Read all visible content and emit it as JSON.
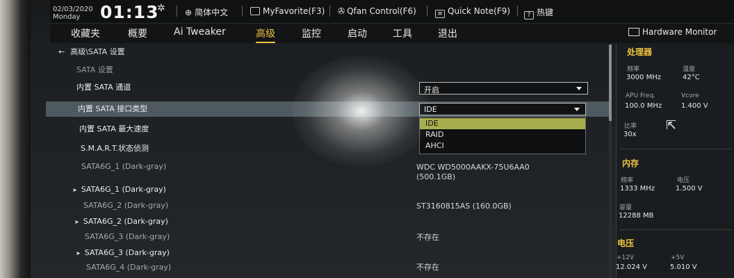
{
  "topbar": {
    "date": "02/03/2020",
    "day": "Monday",
    "time": "01:13",
    "language": "简体中文",
    "myfavorite": "MyFavorite(F3)",
    "qfan": "Qfan Control(F6)",
    "quicknote": "Quick Note(F9)",
    "hotkeys": "热键"
  },
  "menu": {
    "items": [
      "收藏夹",
      "概要",
      "Ai Tweaker",
      "高级",
      "监控",
      "启动",
      "工具",
      "退出"
    ],
    "active": "高级"
  },
  "main": {
    "breadcrumb": "高级\\SATA 设置",
    "subtitle": "SATA 设置",
    "rows": {
      "sata_channel": {
        "label": "内置 SATA 通道",
        "value": "开启"
      },
      "sata_mode": {
        "label": "内置 SATA 接口类型",
        "value": "IDE"
      },
      "sata_speed": {
        "label": "内置 SATA 最大速度"
      },
      "smart": {
        "label": "S.M.A.R.T.状态侦测"
      },
      "port1_info": {
        "label": "SATA6G_1 (Dark-gray)",
        "value_line1": "WDC WD5000AAKX-75U6AA0",
        "value_line2": "(500.1GB)"
      },
      "port1": {
        "label": "SATA6G_1 (Dark-gray)"
      },
      "port2_info": {
        "label": "SATA6G_2 (Dark-gray)",
        "value": "ST3160815AS (160.0GB)"
      },
      "port2": {
        "label": "SATA6G_2 (Dark-gray)"
      },
      "port3_info": {
        "label": "SATA6G_3 (Dark-gray)",
        "value": "不存在"
      },
      "port3": {
        "label": "SATA6G_3 (Dark-gray)"
      },
      "port4_info": {
        "label": "SATA6G_4 (Dark-gray)",
        "value": "不存在"
      }
    },
    "dropdown_options": [
      "IDE",
      "RAID",
      "AHCI"
    ],
    "dropdown_selected": "IDE"
  },
  "hardware_monitor": {
    "title": "Hardware Monitor",
    "cpu": {
      "section": "处理器",
      "freq_label": "频率",
      "freq_value": "3000 MHz",
      "temp_label": "温度",
      "temp_value": "42°C",
      "apu_label": "APU Freq.",
      "apu_value": "100.0 MHz",
      "vcore_label": "Vcore",
      "vcore_value": "1.400 V",
      "ratio_label": "比率",
      "ratio_value": "30x"
    },
    "memory": {
      "section": "内存",
      "freq_label": "频率",
      "freq_value": "1333 MHz",
      "volt_label": "电压",
      "volt_value": "1.500 V",
      "cap_label": "容量",
      "cap_value": "12288 MB"
    },
    "voltage": {
      "section": "电压",
      "v12_label": "+12V",
      "v12_value": "12.024 V",
      "v5_label": "+5V",
      "v5_value": "5.010 V"
    }
  },
  "colors": {
    "accent": "#f0c341",
    "highlight_row": "#4f5a60",
    "selected_option": "#a6ad4c"
  }
}
